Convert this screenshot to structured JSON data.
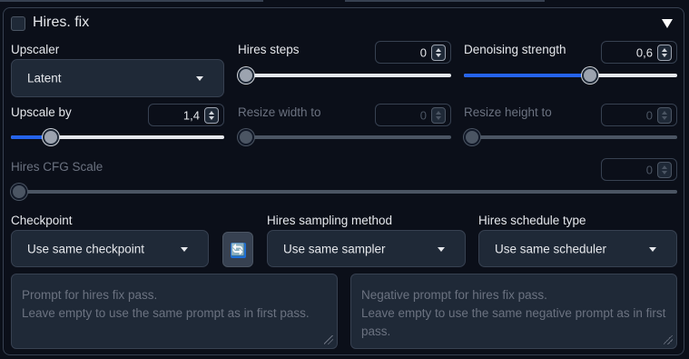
{
  "header": {
    "title": "Hires. fix",
    "enabled": false
  },
  "upscaler": {
    "label": "Upscaler",
    "value": "Latent"
  },
  "hires_steps": {
    "label": "Hires steps",
    "value": "0",
    "slider_fraction": 0.0
  },
  "denoising": {
    "label": "Denoising strength",
    "value": "0,6",
    "slider_fraction": 0.6
  },
  "upscale_by": {
    "label": "Upscale by",
    "value": "1,4",
    "slider_fraction": 0.16
  },
  "resize_width": {
    "label": "Resize width to",
    "value": "0",
    "slider_fraction": 0.0
  },
  "resize_height": {
    "label": "Resize height to",
    "value": "0",
    "slider_fraction": 0.0
  },
  "cfg_scale": {
    "label": "Hires CFG Scale",
    "value": "0",
    "slider_fraction": 0.0
  },
  "checkpoint": {
    "label": "Checkpoint",
    "value": "Use same checkpoint"
  },
  "sampler": {
    "label": "Hires sampling method",
    "value": "Use same sampler"
  },
  "scheduler": {
    "label": "Hires schedule type",
    "value": "Use same scheduler"
  },
  "prompt": {
    "placeholder": "Prompt for hires fix pass.\nLeave empty to use the same prompt as in first pass."
  },
  "negative_prompt": {
    "placeholder": "Negative prompt for hires fix pass.\nLeave empty to use the same negative prompt as in first\npass."
  },
  "icons": {
    "refresh": "🔄"
  },
  "colors": {
    "accent": "#2563eb",
    "background": "#0b0f19",
    "surface": "#1f2937",
    "border": "#374151"
  }
}
